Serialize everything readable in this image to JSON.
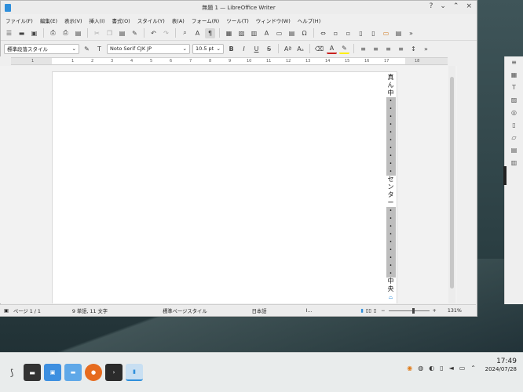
{
  "window": {
    "title": "無題 1 — LibreOffice Writer"
  },
  "menu": [
    "ファイル(F)",
    "編集(E)",
    "表示(V)",
    "挿入(I)",
    "書式(O)",
    "スタイル(Y)",
    "表(A)",
    "フォーム(R)",
    "ツール(T)",
    "ウィンドウ(W)",
    "ヘルプ(H)"
  ],
  "format": {
    "paragraph_style": "標準段落スタイル",
    "font_name": "Noto Serif CJK JP",
    "font_size": "10.5 pt"
  },
  "ruler": {
    "ticks": [
      "1",
      "1",
      "2",
      "3",
      "4",
      "5",
      "6",
      "7",
      "8",
      "9",
      "10",
      "11",
      "12",
      "13",
      "14",
      "15",
      "16",
      "17",
      "18"
    ]
  },
  "document": {
    "top_chars": [
      "真",
      "ん",
      "中"
    ],
    "middle_chars": [
      "セ",
      "ン",
      "タ",
      "ー"
    ],
    "bottom_chars": [
      "中",
      "央"
    ],
    "dot": "・"
  },
  "status": {
    "page": "ページ 1 / 1",
    "words": "9 単語, 11 文字",
    "page_style": "標準ページスタイル",
    "language": "日本語",
    "zoom": "131%"
  },
  "clock": {
    "time": "17:49",
    "date": "2024/07/28"
  },
  "colors": {
    "accent": "#2f8fdb",
    "font_color": "#c9211e",
    "highlight": "#ffee00"
  }
}
